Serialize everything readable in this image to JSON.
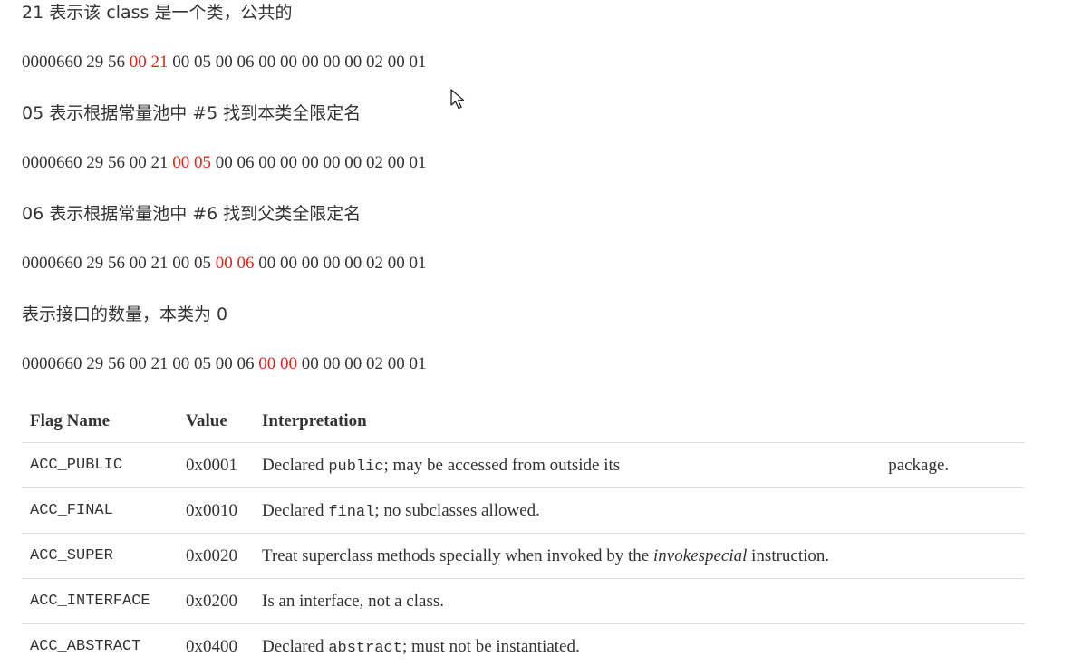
{
  "section1": {
    "caption": "21 表示该 class 是一个类，公共的",
    "hex_pre": "0000660 29 56 ",
    "hex_hl": "00 21",
    "hex_post": " 00 05 00 06 00 00 00 00 00 02 00 01"
  },
  "section2": {
    "caption": "05 表示根据常量池中 #5 找到本类全限定名",
    "hex_pre": "0000660 29 56 00 21 ",
    "hex_hl": "00 05",
    "hex_post": " 00 06 00 00 00 00 00 02 00 01"
  },
  "section3": {
    "caption": "06 表示根据常量池中 #6 找到父类全限定名",
    "hex_pre": "0000660 29 56 00 21 00 05 ",
    "hex_hl": "00 06",
    "hex_post": " 00 00 00 00 00 02 00 01"
  },
  "section4": {
    "caption": "表示接口的数量，本类为 0",
    "hex_pre": "0000660 29 56 00 21 00 05 00 06 ",
    "hex_hl": "00 00",
    "hex_post": " 00 00 00 02 00 01"
  },
  "flags_table": {
    "headers": [
      "Flag Name",
      "Value",
      "Interpretation"
    ],
    "rows": [
      {
        "flag": "ACC_PUBLIC",
        "value": "0x0001",
        "pre": "Declared ",
        "code": "public",
        "post": "; may be accessed from outside its",
        "tail": "package."
      },
      {
        "flag": "ACC_FINAL",
        "value": "0x0010",
        "pre": "Declared ",
        "code": "final",
        "post": "; no subclasses allowed."
      },
      {
        "flag": "ACC_SUPER",
        "value": "0x0020",
        "pre": "Treat superclass methods specially when invoked by the ",
        "em": "invokespecial",
        "post": " instruction."
      },
      {
        "flag": "ACC_INTERFACE",
        "value": "0x0200",
        "pre": "Is an interface, not a class."
      },
      {
        "flag": "ACC_ABSTRACT",
        "value": "0x0400",
        "pre": "Declared ",
        "code": "abstract",
        "post": "; must not be instantiated."
      }
    ]
  },
  "colors": {
    "highlight": "#e2231a",
    "text": "#333333",
    "rule": "#dddddd"
  },
  "icons": {
    "cursor": "mouse-pointer-icon"
  }
}
